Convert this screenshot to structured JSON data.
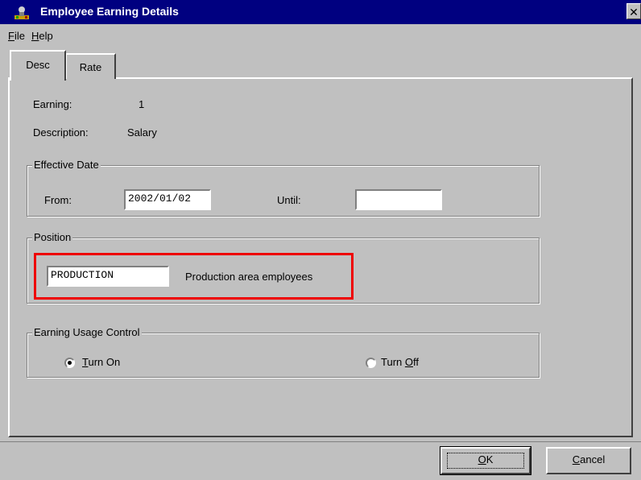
{
  "window": {
    "title": "Employee Earning Details",
    "close_glyph": "✕"
  },
  "icons": {
    "app": "app-icon",
    "close": "close-icon",
    "radio_selected": "radio-selected-icon",
    "radio_unselected": "radio-unselected-icon"
  },
  "colors": {
    "titlebar": "#000080",
    "highlight": "#ee0000",
    "face": "#c0c0c0"
  },
  "menu": {
    "file": {
      "key": "F",
      "rest": "ile"
    },
    "help": {
      "key": "H",
      "rest": "elp"
    }
  },
  "tabs": {
    "desc": "Desc",
    "rate": "Rate",
    "selected": "Desc"
  },
  "fields": {
    "earning_label": "Earning:",
    "earning_value": "1",
    "description_label": "Description:",
    "description_value": "Salary"
  },
  "effective_date": {
    "legend": "Effective Date",
    "from_label": "From:",
    "from_value": "2002/01/02",
    "until_label": "Until:",
    "until_value": ""
  },
  "position": {
    "legend": "Position",
    "code": "PRODUCTION",
    "description": "Production area employees"
  },
  "usage_control": {
    "legend": "Earning Usage Control",
    "turn_on": {
      "key": "T",
      "rest": "urn On"
    },
    "turn_off": {
      "pre": "Turn ",
      "key": "O",
      "rest": "ff"
    },
    "selected": "Turn On"
  },
  "buttons": {
    "ok": {
      "key": "O",
      "rest": "K"
    },
    "cancel": {
      "key": "C",
      "rest": "ancel"
    }
  }
}
